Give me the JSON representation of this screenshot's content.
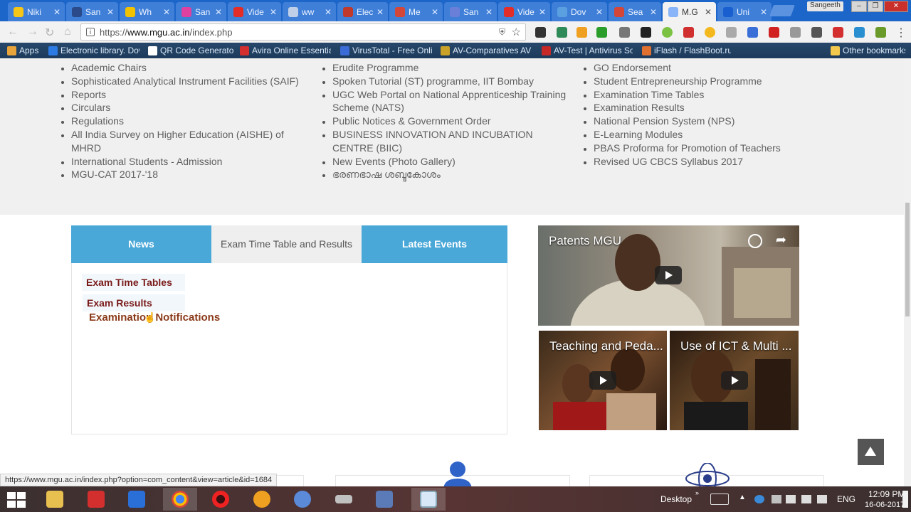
{
  "browser": {
    "tabs": [
      {
        "title": "Niki",
        "color": "#f5c518"
      },
      {
        "title": "San",
        "color": "#2a4a8a"
      },
      {
        "title": "Wh",
        "color": "#f2c200"
      },
      {
        "title": "San",
        "color": "#e040a0"
      },
      {
        "title": "Vide",
        "color": "#e52d27"
      },
      {
        "title": "ww",
        "color": "#bfcfe8"
      },
      {
        "title": "Elec",
        "color": "#c0392b"
      },
      {
        "title": "Me",
        "color": "#d44638"
      },
      {
        "title": "San",
        "color": "#6a7fd8"
      },
      {
        "title": "Vide",
        "color": "#e52d27"
      },
      {
        "title": "Dov",
        "color": "#5aa0e0"
      },
      {
        "title": "Sea",
        "color": "#d44638"
      },
      {
        "title": "M.G",
        "color": "#8ab4f8",
        "active": true
      },
      {
        "title": "Uni",
        "color": "#1a5fd0"
      }
    ],
    "profile_name": "Sangeeth",
    "url_prefix": "https://",
    "url_host": "www.mgu.ac.in",
    "url_path": "/index.php",
    "bookmarks": [
      {
        "label": "Apps",
        "color": "#e8a33a"
      },
      {
        "label": "Electronic library. Dow",
        "color": "#2c7be5"
      },
      {
        "label": "QR Code Generator",
        "color": "#ffffff"
      },
      {
        "label": "Avira Online Essential",
        "color": "#d32f2f"
      },
      {
        "label": "VirusTotal - Free Onli",
        "color": "#3b6bd6"
      },
      {
        "label": "AV-Comparatives AV",
        "color": "#c9a227"
      },
      {
        "label": "AV-Test | Antivirus So",
        "color": "#c62828"
      },
      {
        "label": "iFlash / FlashBoot.ru",
        "color": "#e07030"
      },
      {
        "label": "Other bookmarks",
        "color": "#f2c94c"
      }
    ]
  },
  "links": {
    "col1": [
      "Academic Chairs",
      "Sophisticated Analytical Instrument Facilities (SAIF)",
      "Reports",
      "Circulars",
      "Regulations",
      "All India Survey on Higher Education (AISHE) of MHRD",
      "International Students - Admission",
      "MGU-CAT 2017-'18"
    ],
    "col2": [
      "Erudite Programme",
      "Spoken Tutorial (ST) programme, IIT Bombay",
      "UGC Web Portal on National Apprenticeship Training Scheme (NATS)",
      "Public Notices & Government Order",
      "BUSINESS INNOVATION AND INCUBATION CENTRE (BIIC)",
      "New Events (Photo Gallery)",
      "ഭരണഭാഷ ശബ്ദകോശം"
    ],
    "col3": [
      "GO Endorsement",
      "Student Entrepreneurship Programme",
      "Examination Time Tables",
      "Examination Results",
      "National Pension System (NPS)",
      "E-Learning Modules",
      "PBAS Proforma for Promotion of Teachers",
      "Revised UG CBCS Syllabus 2017"
    ]
  },
  "tabs": {
    "news": "News",
    "exam": "Exam Time Table and Results",
    "events": "Latest Events"
  },
  "panel": {
    "time_tables": "Exam Time Tables",
    "results": "Exam Results",
    "notifications": "Examination Notifications"
  },
  "videos": [
    {
      "title": "Patents MGU"
    },
    {
      "title": "Teaching and Peda..."
    },
    {
      "title": "Use of ICT & Multi ..."
    }
  ],
  "status_url": "https://www.mgu.ac.in/index.php?option=com_content&view=article&id=1684",
  "taskbar": {
    "desktop_label": "Desktop",
    "language": "ENG",
    "time": "12:09 PM",
    "date": "16-06-2017"
  }
}
